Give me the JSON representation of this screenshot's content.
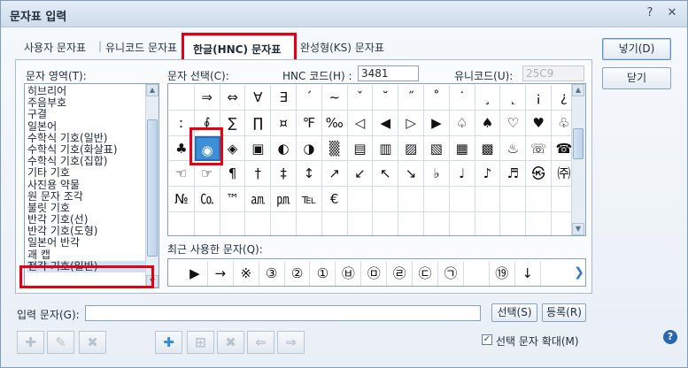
{
  "window": {
    "title": "문자표 입력",
    "help": "?",
    "close": "✕"
  },
  "tabs": [
    {
      "label": "사용자 문자표"
    },
    {
      "label": "|"
    },
    {
      "label": "유니코드 문자표"
    },
    {
      "label": "한글(HNC) 문자표",
      "active": true
    },
    {
      "label": "완성형(KS) 문자표"
    }
  ],
  "labels": {
    "area": "문자 영역(T):",
    "select": "문자 선택(C):",
    "hnc_code": "HNC 코드(H) :",
    "unicode": "유니코드(U):",
    "recent": "최근 사용한 문자(Q):",
    "input": "입력 문자(G):",
    "expand": "선택 문자 확대(M)"
  },
  "fields": {
    "hnc_code": "3481",
    "unicode": "25C9"
  },
  "area_list": [
    "히브리어",
    "주음부호",
    "구결",
    "일본어",
    "수학식 기호(일반)",
    "수학식 기호(화살표)",
    "수학식 기호(집합)",
    "기타 기호",
    "사진용 약물",
    "원 문자 조각",
    "불릿 기호",
    "반각 기호(선)",
    "반각 기호(도형)",
    "일본어 반각",
    "괘 캡",
    "전각 기호(일반)"
  ],
  "area_selected": 15,
  "grid_rows": [
    [
      "",
      "⇒",
      "⇔",
      "∀",
      "∃",
      "´",
      "~",
      "ˇ",
      "˘",
      "˝",
      "˚",
      "˙",
      "¸",
      "˛",
      "¡",
      "¿"
    ],
    [
      "ː",
      "∮",
      "∑",
      "∏",
      "¤",
      "℉",
      "‰",
      "◁",
      "◀",
      "▷",
      "▶",
      "♤",
      "♠",
      "♡",
      "♥",
      "♧"
    ],
    [
      "♣",
      "◉",
      "◈",
      "▣",
      "◐",
      "◑",
      "▒",
      "▤",
      "▥",
      "▨",
      "▧",
      "▦",
      "▩",
      "♨",
      "☏",
      "☎"
    ],
    [
      "☜",
      "☞",
      "¶",
      "†",
      "‡",
      "↕",
      "↗",
      "↙",
      "↖",
      "↘",
      "♭",
      "♩",
      "♪",
      "♬",
      "㉿",
      "㈜"
    ],
    [
      "№",
      "㏇",
      "™",
      "㏂",
      "㏘",
      "℡",
      "€",
      "",
      "",
      "",
      "",
      "",
      "",
      "",
      "",
      ""
    ],
    [
      "",
      "",
      "",
      "",
      "",
      "",
      "",
      "",
      "",
      "",
      "",
      "",
      "",
      "",
      "",
      ""
    ]
  ],
  "grid_selected": {
    "row": 2,
    "col": 1
  },
  "recent": [
    "▶",
    "→",
    "※",
    "③",
    "②",
    "①",
    "㉥",
    "㉤",
    "㉣",
    "㉢",
    "㉠",
    "",
    "⑲",
    "↓"
  ],
  "buttons": {
    "insert": "넣기(D)",
    "close": "닫기",
    "choose": "선택(S)",
    "register": "등록(R)"
  },
  "toolbar": [
    {
      "icon": "add-char-icon",
      "glyph": "✚",
      "enabled": false
    },
    {
      "icon": "edit-char-icon",
      "glyph": "✎",
      "enabled": false
    },
    {
      "icon": "remove-char-icon",
      "glyph": "✖",
      "enabled": false
    },
    {
      "icon": "add-icon",
      "glyph": "✚",
      "enabled": true
    },
    {
      "icon": "insert-icon",
      "glyph": "⊞",
      "enabled": false
    },
    {
      "icon": "delete-icon",
      "glyph": "✖",
      "enabled": false
    },
    {
      "icon": "left-arrow-icon",
      "glyph": "⇐",
      "enabled": false
    },
    {
      "icon": "right-arrow-icon",
      "glyph": "⇒",
      "enabled": false
    }
  ],
  "expand_checked": true,
  "colors": {
    "highlight": "#e60012",
    "selection": "#3f8fd8"
  }
}
